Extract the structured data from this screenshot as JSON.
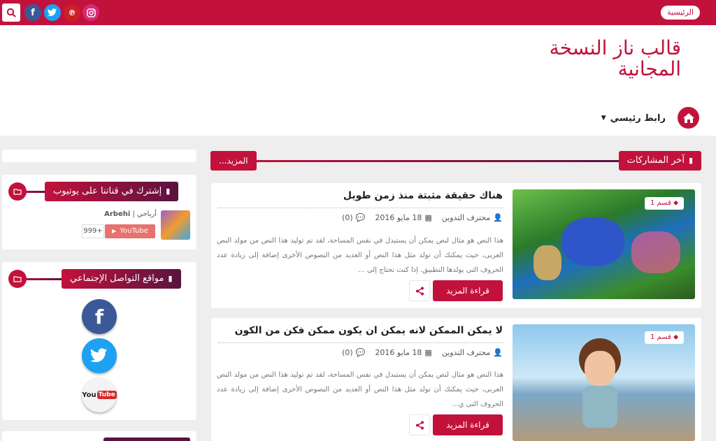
{
  "topbar": {
    "home_label": "الرئيسية",
    "social": [
      "instagram-icon",
      "pinterest-icon",
      "twitter-icon",
      "facebook-icon"
    ],
    "colors": {
      "instagram": "#d62976",
      "pinterest": "#cb2027",
      "twitter": "#1da1f2",
      "facebook": "#3b5998"
    }
  },
  "header": {
    "title": "قالب ناز النسخة المجانية"
  },
  "nav": {
    "main_link": "رابط رئيسي"
  },
  "section": {
    "title": "آخر المشاركات",
    "more": "المزيد..."
  },
  "posts": [
    {
      "category": "قسم 1",
      "title": "هناك حقيقة مثبتة منذ زمن طويل",
      "author": "محترف التدوين",
      "date": "18 مايو 2016",
      "comments": "(0)",
      "excerpt": "هذا النص هو مثال لنص يمكن أن يستبدل في نفس المساحة، لقد تم توليد هذا النص من مولد النص العربى، حيث يمكنك أن تولد مثل هذا النص أو العديد من النصوص الأخرى إضافة إلى زيادة عدد الحروف التى يولدها التطبيق. إذا كنت تحتاج إلى ...",
      "read_more": "قراءة المزيد"
    },
    {
      "category": "قسم 1",
      "title": "لا يمكن الممكن لانه يمكن ان يكون ممكن فكن من الكون",
      "author": "محترف التدوين",
      "date": "18 مايو 2016",
      "comments": "(0)",
      "excerpt": "هذا النص هو مثال لنص يمكن أن يستبدل في نفس المساحة، لقد تم توليد هذا النص من مولد النص العربى، حيث يمكنك أن تولد  مثل هذا النص أو العديد من النصوص الأخرى إضافة إلى زيادة عدد الحروف التى ي...",
      "read_more": "قراءة المزيد"
    }
  ],
  "sidebar": {
    "youtube_widget": {
      "title": "إشترك في قناتنا على يوتيوب",
      "channel_name": "Arbehi",
      "channel_sub": "أرباحي |",
      "button": "YouTube",
      "count": "999+"
    },
    "social_widget": {
      "title": "مواقع التواصل الإجتماعي",
      "items": [
        {
          "icon": "facebook-icon",
          "glyph": "f",
          "color": "#3b5998"
        },
        {
          "icon": "twitter-icon",
          "glyph": "t",
          "color": "#1da1f2"
        },
        {
          "icon": "youtube-icon",
          "glyph": "You Tube",
          "color": "#d92626"
        }
      ]
    }
  },
  "accent_color": "#c2123c"
}
